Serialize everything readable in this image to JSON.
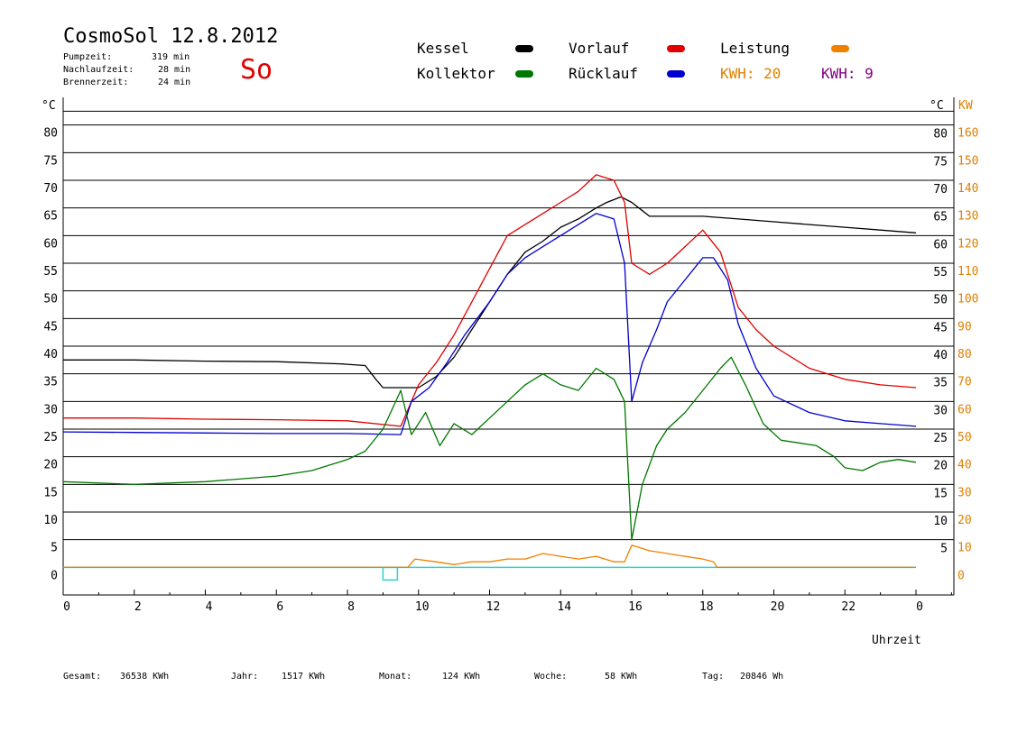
{
  "header": {
    "title": "CosmoSol 12.8.2012",
    "day": "So",
    "stats": [
      {
        "label": "Pumpzeit:",
        "value": "319 min"
      },
      {
        "label": "Nachlaufzeit:",
        "value": "28 min"
      },
      {
        "label": "Brennerzeit:",
        "value": "24 min"
      }
    ]
  },
  "legend": {
    "items": [
      {
        "label": "Kessel",
        "color": "#000000"
      },
      {
        "label": "Vorlauf",
        "color": "#e00000"
      },
      {
        "label": "Leistung",
        "color": "#f08000"
      },
      {
        "label": "Kollektor",
        "color": "#007800"
      },
      {
        "label": "Rücklauf",
        "color": "#0000d0"
      }
    ],
    "kwh_orange": "KWH: 20",
    "kwh_purple": "KWH: 9"
  },
  "footer": [
    {
      "label": "Gesamt:",
      "value": "36538 KWh"
    },
    {
      "label": "Jahr:",
      "value": "1517 KWh"
    },
    {
      "label": "Monat:",
      "value": "124 KWh"
    },
    {
      "label": "Woche:",
      "value": "58 KWh"
    },
    {
      "label": "Tag:",
      "value": "20846 Wh"
    }
  ],
  "chart_data": {
    "type": "line",
    "xlabel": "Uhrzeit",
    "ylabel_left": "°C",
    "ylabel_right": "°C",
    "ylabel_right2": "KW",
    "xlim": [
      0,
      25
    ],
    "ylim": [
      -5,
      85
    ],
    "ylim_kw": [
      -10,
      170
    ],
    "grid": true,
    "x_ticks": [
      0,
      2,
      4,
      6,
      8,
      10,
      12,
      14,
      16,
      18,
      20,
      22,
      24
    ],
    "x_tick_labels": [
      "0",
      "2",
      "4",
      "6",
      "8",
      "10",
      "12",
      "14",
      "16",
      "18",
      "20",
      "22",
      "0"
    ],
    "y_ticks": [
      0,
      5,
      10,
      15,
      20,
      25,
      30,
      35,
      40,
      45,
      50,
      55,
      60,
      65,
      70,
      75,
      80
    ],
    "y_right_ticks": [
      5,
      10,
      15,
      20,
      25,
      30,
      35,
      40,
      45,
      50,
      55,
      60,
      65,
      70,
      75,
      80
    ],
    "kw_ticks": [
      0,
      10,
      20,
      30,
      40,
      50,
      60,
      70,
      80,
      90,
      100,
      110,
      120,
      130,
      140,
      150,
      160
    ],
    "series": [
      {
        "name": "Kessel",
        "color": "#000000",
        "x": [
          0,
          2,
          4,
          6,
          7.8,
          8.5,
          8.8,
          9.0,
          9.5,
          10.0,
          10.5,
          11,
          11.5,
          12,
          12.5,
          13,
          13.5,
          14,
          14.5,
          15,
          15.3,
          15.7,
          16.0,
          16.3,
          16.5,
          17,
          18,
          19,
          20,
          21,
          22,
          23,
          24
        ],
        "y": [
          37.5,
          37.5,
          37.3,
          37.2,
          36.8,
          36.5,
          34,
          32.5,
          32.5,
          32.5,
          34.5,
          38,
          43,
          48,
          53,
          57,
          59,
          61.5,
          63,
          65,
          66,
          67,
          66,
          64.5,
          63.5,
          63.5,
          63.5,
          63,
          62.5,
          62,
          61.5,
          61,
          60.5
        ]
      },
      {
        "name": "Vorlauf",
        "color": "#e00000",
        "x": [
          0,
          2,
          4,
          6,
          8,
          9.5,
          10.0,
          10.5,
          11,
          11.5,
          12,
          12.5,
          13,
          13.5,
          14,
          14.5,
          15,
          15.5,
          15.8,
          16.0,
          16.5,
          17,
          17.5,
          18,
          18.5,
          19,
          19.5,
          20,
          21,
          22,
          23,
          24
        ],
        "y": [
          27,
          27,
          26.8,
          26.7,
          26.5,
          25.5,
          33,
          37,
          42,
          48,
          54,
          60,
          62,
          64,
          66,
          68,
          71,
          70,
          66,
          55,
          53,
          55,
          58,
          61,
          57,
          47,
          43,
          40,
          36,
          34,
          33,
          32.5
        ]
      },
      {
        "name": "Rücklauf",
        "color": "#0000d0",
        "x": [
          0,
          2,
          4,
          6,
          8,
          9.5,
          9.8,
          10.3,
          10.8,
          11.3,
          12,
          12.5,
          13,
          13.5,
          14,
          14.5,
          15,
          15.5,
          15.8,
          16.0,
          16.3,
          16.7,
          17,
          17.5,
          18,
          18.3,
          18.7,
          19,
          19.5,
          20,
          21,
          22,
          23,
          24
        ],
        "y": [
          24.5,
          24.4,
          24.3,
          24.2,
          24.2,
          24,
          30,
          32.5,
          37,
          42,
          48,
          53,
          56,
          58,
          60,
          62,
          64,
          63,
          55,
          30,
          37,
          43,
          48,
          52,
          56,
          56,
          52,
          44,
          36,
          31,
          28,
          26.5,
          26,
          25.5
        ]
      },
      {
        "name": "Kollektor",
        "color": "#007800",
        "x": [
          0,
          2,
          4,
          6,
          7,
          8,
          8.5,
          9,
          9.5,
          9.8,
          10.2,
          10.6,
          11,
          11.5,
          12,
          12.5,
          13,
          13.5,
          14,
          14.5,
          15,
          15.5,
          15.8,
          16.0,
          16.3,
          16.7,
          17,
          17.5,
          18,
          18.5,
          18.8,
          19.2,
          19.7,
          20.2,
          20.7,
          21.2,
          21.7,
          22,
          22.5,
          23,
          23.5,
          24
        ],
        "y": [
          15.5,
          15,
          15.5,
          16.5,
          17.5,
          19.5,
          21,
          25,
          32,
          24,
          28,
          22,
          26,
          24,
          27,
          30,
          33,
          35,
          33,
          32,
          36,
          34,
          30,
          5,
          15,
          22,
          25,
          28,
          32,
          36,
          38,
          33,
          26,
          23,
          22.5,
          22,
          20,
          18,
          17.5,
          19,
          19.5,
          19
        ]
      },
      {
        "name": "Leistung",
        "color": "#f08000",
        "axis": "kw",
        "x": [
          0,
          9.7,
          9.9,
          10.5,
          11,
          11.5,
          12,
          12.5,
          13,
          13.5,
          14,
          14.5,
          15,
          15.5,
          15.8,
          16.0,
          16.5,
          17,
          17.5,
          18,
          18.3,
          18.4,
          24
        ],
        "y": [
          0,
          0,
          3,
          2,
          1,
          2,
          2,
          3,
          3,
          5,
          4,
          3,
          4,
          2,
          2,
          8,
          6,
          5,
          4,
          3,
          2,
          0,
          0
        ]
      }
    ]
  }
}
